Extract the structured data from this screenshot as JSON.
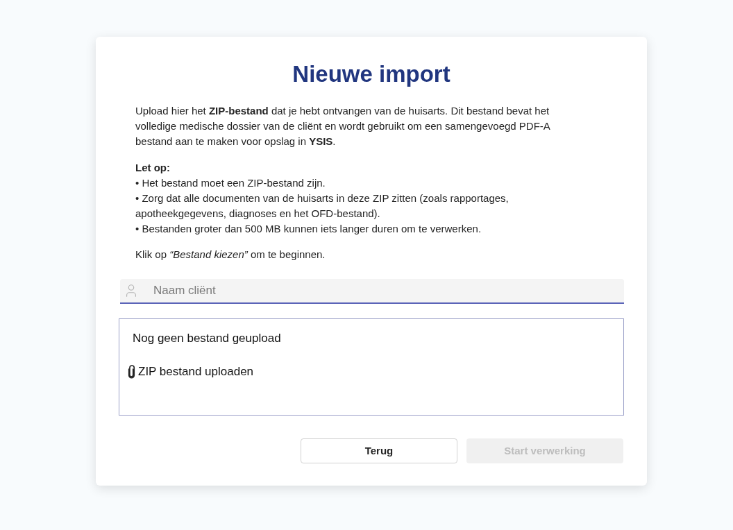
{
  "title": "Nieuwe import",
  "intro": "Upload hier het **ZIP-bestand** dat je hebt ontvangen van de huisarts. Dit bestand bevat het volledige medische dossier van de cliënt en wordt gebruikt om een samengevoegd PDF-A bestand aan te maken voor opslag in **YSIS**.",
  "notice": {
    "heading": "Let op:",
    "items": [
      "• Het bestand moet een ZIP-bestand zijn.",
      "• Zorg dat alle documenten van de huisarts in deze ZIP zitten (zoals rapportages, apotheekgegevens, diagnoses en het OFD-bestand).",
      "• Bestanden groter dan 500 MB kunnen iets langer duren om te verwerken."
    ]
  },
  "hint": "Klik op *“Bestand kiezen”* om te beginnen.",
  "client_field": {
    "placeholder": "Naam cliënt"
  },
  "upload": {
    "status": "Nog geen bestand geupload",
    "action": "ZIP bestand uploaden"
  },
  "buttons": [
    {
      "label": "Terug",
      "disabled": false
    },
    {
      "label": "Start verwerking",
      "disabled": true
    }
  ]
}
